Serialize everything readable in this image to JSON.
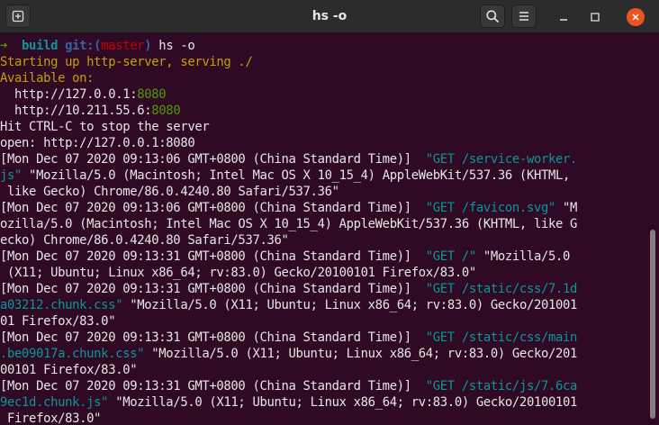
{
  "window": {
    "title": "hs -o"
  },
  "header": {
    "new_tab_icon": "new-tab-icon",
    "search_icon": "search-icon",
    "menu_icon": "hamburger-menu-icon",
    "minimize_icon": "minimize-icon",
    "maximize_icon": "maximize-icon",
    "close_icon": "close-icon"
  },
  "colors": {
    "background": "#300a24",
    "header": "#2c2c2c",
    "text": "#e6e6e6",
    "yellow": "#c4a000",
    "green": "#4e9a06",
    "cyan": "#06989a",
    "blue": "#3465a4",
    "red": "#cc0000",
    "close_button": "#e95420"
  },
  "terminal": {
    "lines": [
      [
        {
          "t": "➜  ",
          "c": "green-b"
        },
        {
          "t": "build ",
          "c": "cyan-b"
        },
        {
          "t": "git:(",
          "c": "blue-b"
        },
        {
          "t": "master",
          "c": "red"
        },
        {
          "t": ")",
          "c": "blue-b"
        },
        {
          "t": " hs -o",
          "c": "white"
        }
      ],
      [
        {
          "t": "Starting up http-server, serving ./",
          "c": "yellow"
        }
      ],
      [
        {
          "t": "Available on:",
          "c": "yellow"
        }
      ],
      [
        {
          "t": "  http://127.0.0.1:",
          "c": "white"
        },
        {
          "t": "8080",
          "c": "green"
        }
      ],
      [
        {
          "t": "  http://10.211.55.6:",
          "c": "white"
        },
        {
          "t": "8080",
          "c": "green"
        }
      ],
      [
        {
          "t": "Hit CTRL-C to stop the server",
          "c": "white"
        }
      ],
      [
        {
          "t": "open: http://127.0.0.1:8080",
          "c": "white"
        }
      ],
      [
        {
          "t": "[Mon Dec 07 2020 09:13:06 GMT+0800 (China Standard Time)]  ",
          "c": "white"
        },
        {
          "t": "\"GET /service-worker.",
          "c": "cyan"
        }
      ],
      [
        {
          "t": "js\"",
          "c": "cyan"
        },
        {
          "t": " \"Mozilla/5.0 (Macintosh; Intel Mac OS X 10_15_4) AppleWebKit/537.36 (KHTML,",
          "c": "white"
        }
      ],
      [
        {
          "t": " like Gecko) Chrome/86.0.4240.80 Safari/537.36\"",
          "c": "white"
        }
      ],
      [
        {
          "t": "[Mon Dec 07 2020 09:13:06 GMT+0800 (China Standard Time)]  ",
          "c": "white"
        },
        {
          "t": "\"GET /favicon.svg\"",
          "c": "cyan"
        },
        {
          "t": " \"M",
          "c": "white"
        }
      ],
      [
        {
          "t": "ozilla/5.0 (Macintosh; Intel Mac OS X 10_15_4) AppleWebKit/537.36 (KHTML, like G",
          "c": "white"
        }
      ],
      [
        {
          "t": "ecko) Chrome/86.0.4240.80 Safari/537.36\"",
          "c": "white"
        }
      ],
      [
        {
          "t": "[Mon Dec 07 2020 09:13:31 GMT+0800 (China Standard Time)]  ",
          "c": "white"
        },
        {
          "t": "\"GET /\"",
          "c": "cyan"
        },
        {
          "t": " \"Mozilla/5.0",
          "c": "white"
        }
      ],
      [
        {
          "t": " (X11; Ubuntu; Linux x86_64; rv:83.0) Gecko/20100101 Firefox/83.0\"",
          "c": "white"
        }
      ],
      [
        {
          "t": "[Mon Dec 07 2020 09:13:31 GMT+0800 (China Standard Time)]  ",
          "c": "white"
        },
        {
          "t": "\"GET /static/css/7.1d",
          "c": "cyan"
        }
      ],
      [
        {
          "t": "a03212.chunk.css\"",
          "c": "cyan"
        },
        {
          "t": " \"Mozilla/5.0 (X11; Ubuntu; Linux x86_64; rv:83.0) Gecko/201001",
          "c": "white"
        }
      ],
      [
        {
          "t": "01 Firefox/83.0\"",
          "c": "white"
        }
      ],
      [
        {
          "t": "[Mon Dec 07 2020 09:13:31 GMT+0800 (China Standard Time)]  ",
          "c": "white"
        },
        {
          "t": "\"GET /static/css/main",
          "c": "cyan"
        }
      ],
      [
        {
          "t": ".be09017a.chunk.css\"",
          "c": "cyan"
        },
        {
          "t": " \"Mozilla/5.0 (X11; Ubuntu; Linux x86_64; rv:83.0) Gecko/201",
          "c": "white"
        }
      ],
      [
        {
          "t": "00101 Firefox/83.0\"",
          "c": "white"
        }
      ],
      [
        {
          "t": "[Mon Dec 07 2020 09:13:31 GMT+0800 (China Standard Time)]  ",
          "c": "white"
        },
        {
          "t": "\"GET /static/js/7.6ca",
          "c": "cyan"
        }
      ],
      [
        {
          "t": "9ec1d.chunk.js\"",
          "c": "cyan"
        },
        {
          "t": " \"Mozilla/5.0 (X11; Ubuntu; Linux x86_64; rv:83.0) Gecko/20100101",
          "c": "white"
        }
      ],
      [
        {
          "t": " Firefox/83.0\"",
          "c": "white"
        }
      ]
    ]
  }
}
